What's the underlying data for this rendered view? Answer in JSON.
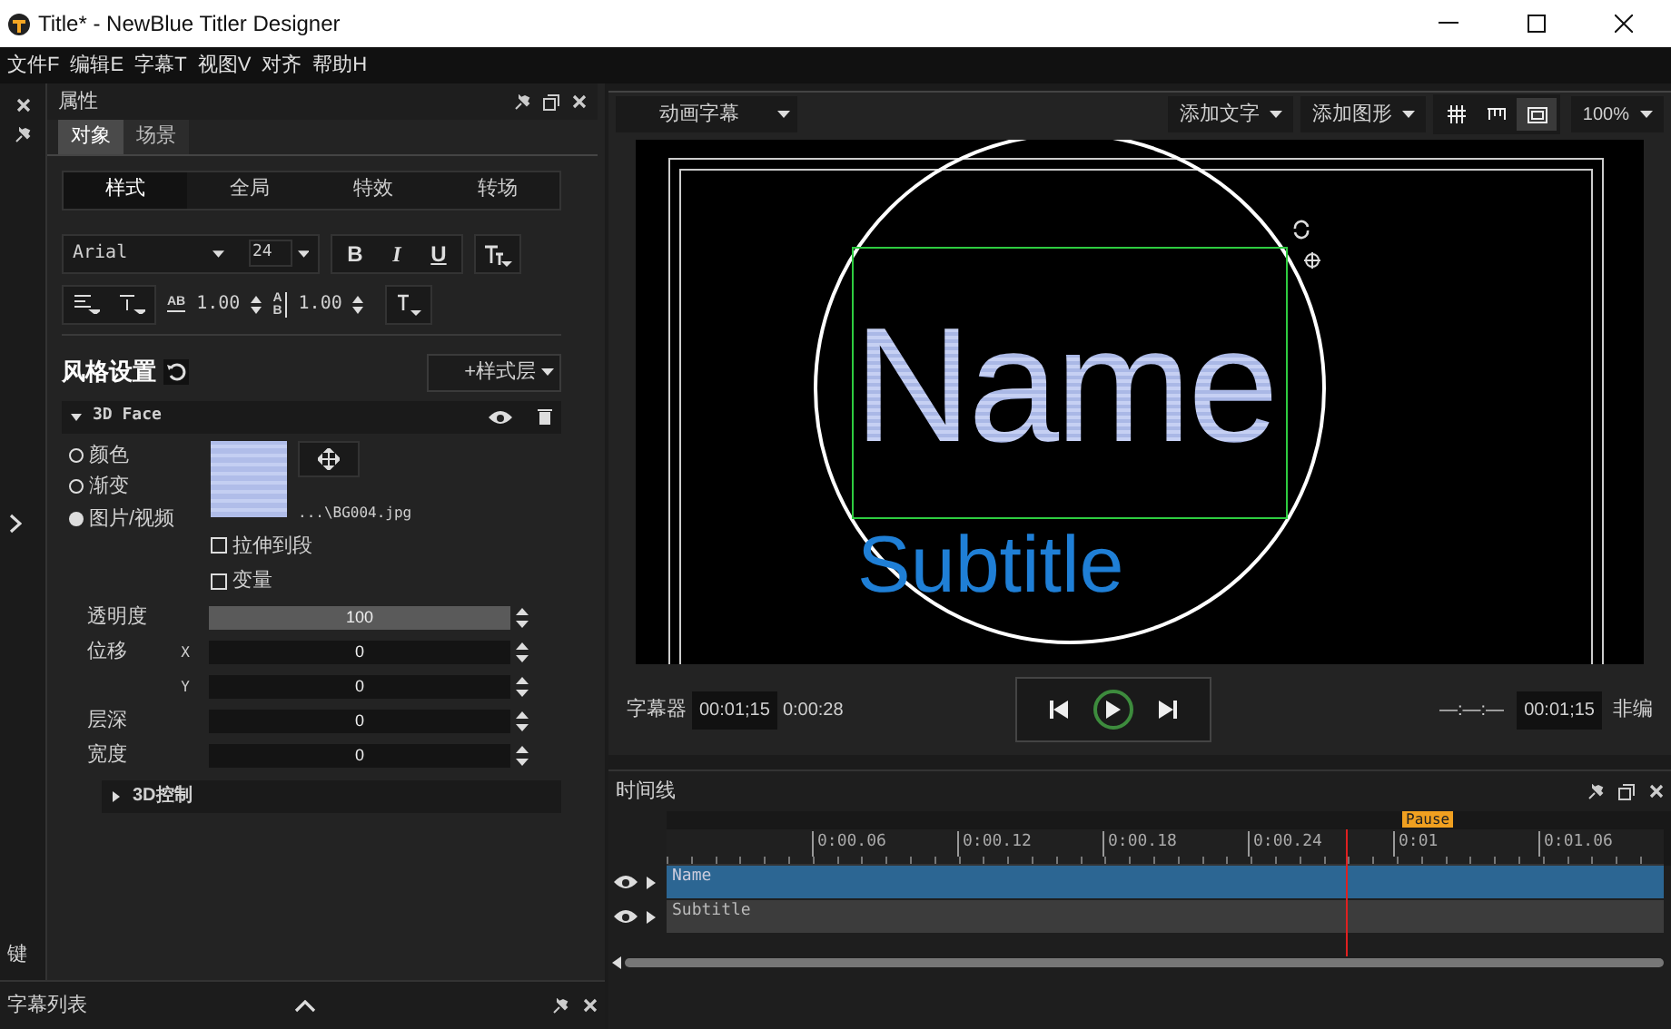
{
  "window": {
    "title": "Title* - NewBlue Titler Designer"
  },
  "menu": [
    "文件F",
    "编辑E",
    "字幕T",
    "视图V",
    "对齐",
    "帮助H"
  ],
  "left_strip": {
    "label": "键"
  },
  "properties": {
    "title": "属性",
    "tabs": [
      {
        "label": "对象",
        "selected": true
      },
      {
        "label": "场景",
        "selected": false
      }
    ],
    "subtabs": [
      {
        "label": "样式",
        "selected": true
      },
      {
        "label": "全局",
        "selected": false
      },
      {
        "label": "特效",
        "selected": false
      },
      {
        "label": "转场",
        "selected": false
      }
    ],
    "font": "Arial",
    "size": "24",
    "format_buttons": [
      "B",
      "I",
      "U"
    ],
    "tracking_mark": "AB",
    "tracking": "1.00",
    "leading_marks": [
      "A",
      "B"
    ],
    "leading": "1.00",
    "style_title": "风格设置",
    "add_layer": "+样式层",
    "layer": {
      "name": "3D Face",
      "expanded": true
    },
    "fill_options": [
      {
        "label": "颜色",
        "selected": false
      },
      {
        "label": "渐变",
        "selected": false
      },
      {
        "label": "图片/视频",
        "selected": true
      }
    ],
    "file": "...\\BG004.jpg",
    "checkboxes": [
      {
        "label": "拉伸到段",
        "checked": false
      },
      {
        "label": "变量",
        "checked": false
      }
    ],
    "fields": [
      {
        "label": "透明度",
        "value": "100",
        "level": 1
      },
      {
        "label": "位移",
        "axis": "X",
        "value": "0"
      },
      {
        "axis": "Y",
        "value": "0"
      },
      {
        "label": "层深",
        "value": "0"
      },
      {
        "label": "宽度",
        "value": "0"
      }
    ],
    "section": {
      "label": "3D控制",
      "expanded": false
    }
  },
  "subtitle_list": {
    "title": "字幕列表"
  },
  "toolbar": {
    "mode": "动画字幕",
    "add_text": "添加文字",
    "add_shape": "添加图形",
    "views": [
      {
        "selected": false
      },
      {
        "selected": false
      },
      {
        "selected": true
      }
    ],
    "zoom": "100%"
  },
  "canvas": {
    "title_text": "Name",
    "subtitle_text": "Subtitle"
  },
  "transport": {
    "label": "字幕器",
    "current": "00:01;15",
    "duration": "0:00:28",
    "mark": "—:—:—",
    "out": "00:01;15",
    "right_label": "非编"
  },
  "timeline": {
    "title": "时间线",
    "marker": "Pause",
    "ticks": [
      "0:00.06",
      "0:00.12",
      "0:00.18",
      "0:00.24",
      "0:01",
      "0:01.06"
    ],
    "tracks": [
      {
        "name": "Name",
        "selected": true
      },
      {
        "name": "Subtitle",
        "selected": false
      }
    ]
  }
}
